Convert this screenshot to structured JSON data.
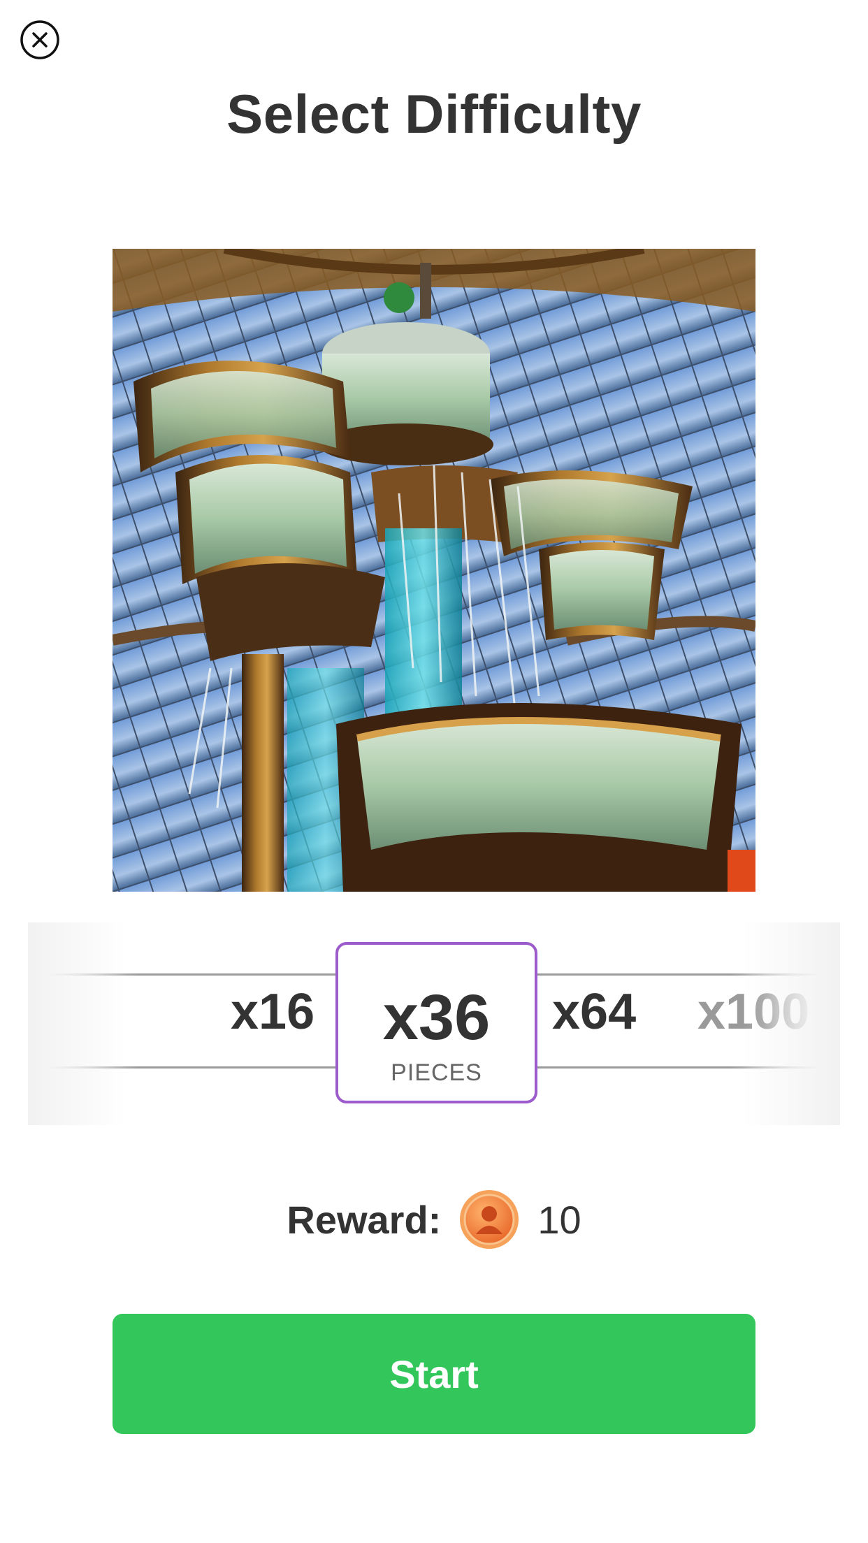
{
  "header": {
    "close_icon": "close-circle-icon",
    "title": "Select Difficulty"
  },
  "puzzle": {
    "image_subject": "fountain-under-glass-dome-photo"
  },
  "difficulty": {
    "options": [
      {
        "label": "x16"
      },
      {
        "label": "x36"
      },
      {
        "label": "x64"
      },
      {
        "label": "x100"
      }
    ],
    "selected": {
      "value": "x36",
      "unit": "PIECES"
    },
    "accent_color": "#9c5ccc"
  },
  "reward": {
    "label": "Reward:",
    "coin_icon": "coin-icon",
    "value": "10"
  },
  "start": {
    "label": "Start",
    "color": "#33c65a"
  }
}
